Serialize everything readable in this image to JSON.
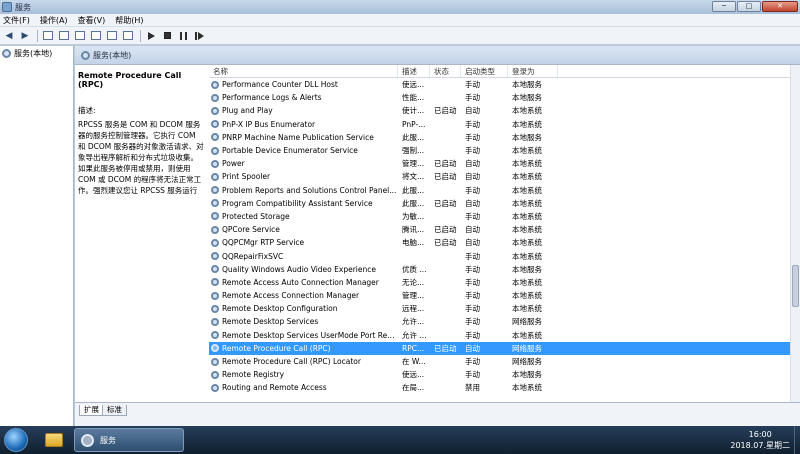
{
  "window": {
    "title": "服务",
    "controls": {
      "minimize": "─",
      "maximize": "□",
      "close": "✕"
    }
  },
  "menu": [
    "文件(F)",
    "操作(A)",
    "查看(V)",
    "帮助(H)"
  ],
  "tree": {
    "item": "服务(本地)"
  },
  "main": {
    "header": "服务(本地)",
    "selected_name": "Remote Procedure Call (RPC)",
    "desc_label": "描述:",
    "desc_text": "RPCSS 服务是 COM 和 DCOM 服务器的服务控制管理器。它执行 COM 和 DCOM 服务器的对象激活请求、对象导出程序解析和分布式垃圾收集。如果此服务被停用或禁用，则使用 COM 或 DCOM 的程序将无法正常工作。强烈建议您让 RPCSS 服务运行"
  },
  "columns": {
    "name": "名称",
    "desc": "描述",
    "status": "状态",
    "start": "启动类型",
    "logon": "登录为"
  },
  "rows": [
    {
      "name": "Performance Counter DLL Host",
      "desc": "使远...",
      "status": "",
      "start": "手动",
      "logon": "本地服务"
    },
    {
      "name": "Performance Logs & Alerts",
      "desc": "性能...",
      "status": "",
      "start": "手动",
      "logon": "本地服务"
    },
    {
      "name": "Plug and Play",
      "desc": "使计...",
      "status": "已启动",
      "start": "自动",
      "logon": "本地系统"
    },
    {
      "name": "PnP-X IP Bus Enumerator",
      "desc": "PnP-...",
      "status": "",
      "start": "手动",
      "logon": "本地系统"
    },
    {
      "name": "PNRP Machine Name Publication Service",
      "desc": "此服...",
      "status": "",
      "start": "手动",
      "logon": "本地服务"
    },
    {
      "name": "Portable Device Enumerator Service",
      "desc": "强制...",
      "status": "",
      "start": "手动",
      "logon": "本地系统"
    },
    {
      "name": "Power",
      "desc": "管理...",
      "status": "已启动",
      "start": "自动",
      "logon": "本地系统"
    },
    {
      "name": "Print Spooler",
      "desc": "将文...",
      "status": "已启动",
      "start": "自动",
      "logon": "本地系统"
    },
    {
      "name": "Problem Reports and Solutions Control Panel...",
      "desc": "此服...",
      "status": "",
      "start": "手动",
      "logon": "本地系统"
    },
    {
      "name": "Program Compatibility Assistant Service",
      "desc": "此服...",
      "status": "已启动",
      "start": "自动",
      "logon": "本地系统"
    },
    {
      "name": "Protected Storage",
      "desc": "为敏...",
      "status": "",
      "start": "手动",
      "logon": "本地系统"
    },
    {
      "name": "QPCore Service",
      "desc": "腾讯...",
      "status": "已启动",
      "start": "自动",
      "logon": "本地系统"
    },
    {
      "name": "QQPCMgr RTP Service",
      "desc": "电脑...",
      "status": "已启动",
      "start": "自动",
      "logon": "本地系统"
    },
    {
      "name": "QQRepairFixSVC",
      "desc": "",
      "status": "",
      "start": "手动",
      "logon": "本地系统"
    },
    {
      "name": "Quality Windows Audio Video Experience",
      "desc": "优质 ...",
      "status": "",
      "start": "手动",
      "logon": "本地服务"
    },
    {
      "name": "Remote Access Auto Connection Manager",
      "desc": "无论...",
      "status": "",
      "start": "手动",
      "logon": "本地系统"
    },
    {
      "name": "Remote Access Connection Manager",
      "desc": "管理...",
      "status": "",
      "start": "手动",
      "logon": "本地系统"
    },
    {
      "name": "Remote Desktop Configuration",
      "desc": "远程...",
      "status": "",
      "start": "手动",
      "logon": "本地系统"
    },
    {
      "name": "Remote Desktop Services",
      "desc": "允许...",
      "status": "",
      "start": "手动",
      "logon": "网络服务"
    },
    {
      "name": "Remote Desktop Services UserMode Port Re...",
      "desc": "允许 ...",
      "status": "",
      "start": "手动",
      "logon": "本地系统"
    },
    {
      "name": "Remote Procedure Call (RPC)",
      "desc": "RPC...",
      "status": "已启动",
      "start": "自动",
      "logon": "网络服务",
      "selected": true
    },
    {
      "name": "Remote Procedure Call (RPC) Locator",
      "desc": "在 W...",
      "status": "",
      "start": "手动",
      "logon": "网络服务"
    },
    {
      "name": "Remote Registry",
      "desc": "使远...",
      "status": "",
      "start": "手动",
      "logon": "本地服务"
    },
    {
      "name": "Routing and Remote Access",
      "desc": "在局...",
      "status": "",
      "start": "禁用",
      "logon": "本地系统"
    }
  ],
  "tabs": {
    "extended": "扩展",
    "standard": "标准"
  },
  "taskbar": {
    "services_label": "服务",
    "time": "16:00",
    "date": "2018.07.星期二"
  }
}
